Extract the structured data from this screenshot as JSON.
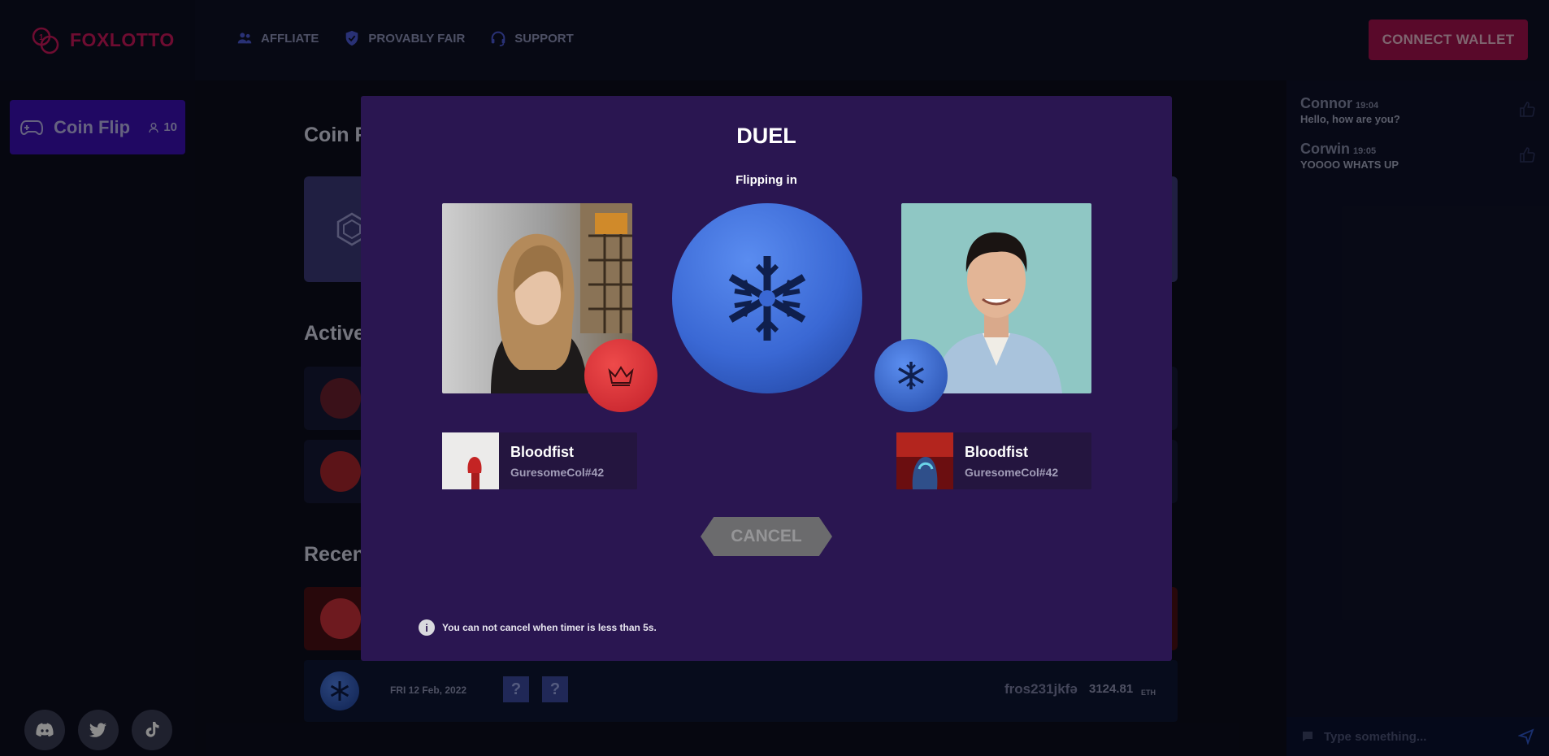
{
  "brand": {
    "name": "FOXLOTTO",
    "accent": "#c8175a"
  },
  "nav": [
    {
      "label": "AFFLIATE",
      "icon": "users-icon"
    },
    {
      "label": "PROVABLY FAIR",
      "icon": "shield-check-icon"
    },
    {
      "label": "SUPPORT",
      "icon": "headset-icon"
    }
  ],
  "connect_wallet_label": "CONNECT WALLET",
  "sidebar": {
    "game_label": "Coin Flip",
    "players_count": "10",
    "icon": "gamepad-icon"
  },
  "socials": [
    "discord-icon",
    "twitter-icon",
    "tiktok-icon"
  ],
  "main": {
    "title_partial": "Coin F",
    "active_title_partial": "Active",
    "recent_title_partial": "Recen",
    "bottom_row": {
      "date": "FRI 12 Feb, 2022",
      "q1": "?",
      "q2": "?",
      "wallet": "fros231jkfə",
      "amount": "3124.81",
      "unit": "ETH"
    }
  },
  "chat": {
    "messages": [
      {
        "user": "Connor",
        "time": "19:04",
        "text": "Hello, how are you?"
      },
      {
        "user": "Corwin",
        "time": "19:05",
        "text": "YOOOO WHATS UP"
      }
    ],
    "input_placeholder": "Type something..."
  },
  "modal": {
    "title": "DUEL",
    "flip_label": "Flipping in",
    "left_player": {
      "name": "Bloodfist",
      "tag": "GuresomeCol#42",
      "side": "crown"
    },
    "right_player": {
      "name": "Bloodfist",
      "tag": "GuresomeCol#42",
      "side": "snowflake"
    },
    "cancel_label": "CANCEL",
    "notice": "You can not cancel when timer is less than 5s.",
    "notice_icon": "i"
  }
}
